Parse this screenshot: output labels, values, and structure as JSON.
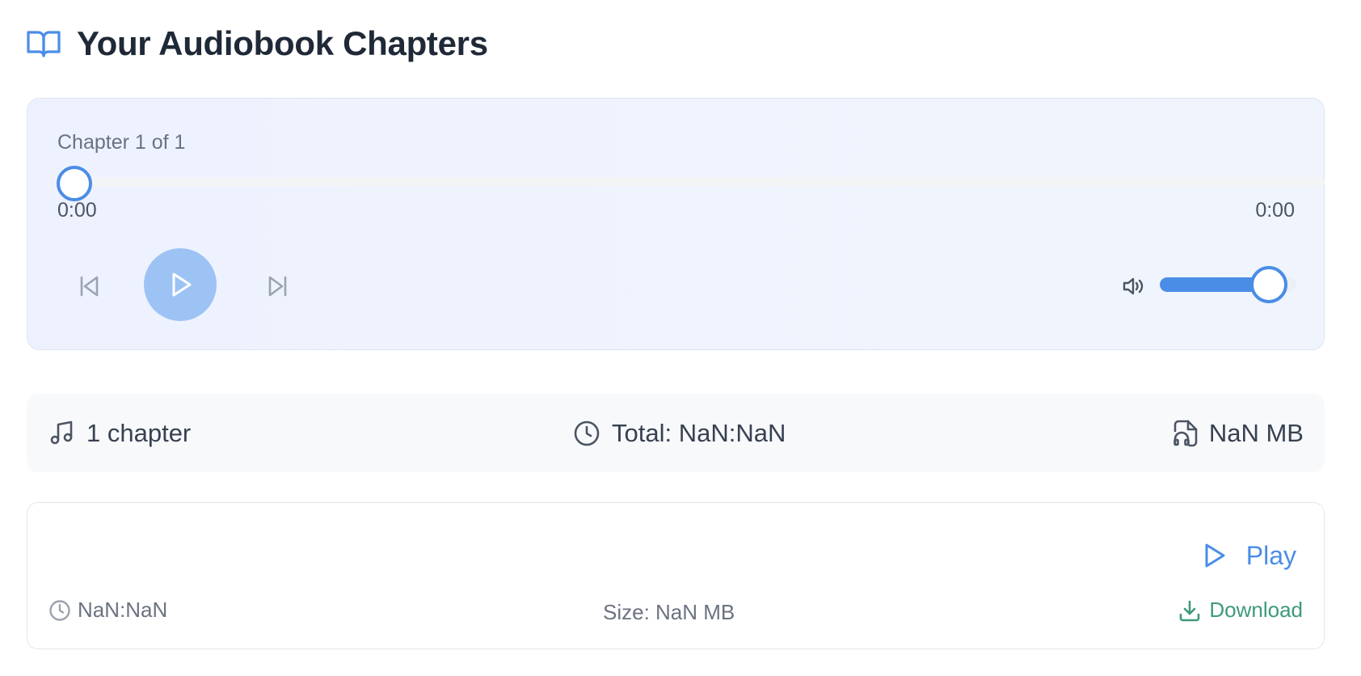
{
  "header": {
    "title": "Your Audiobook Chapters",
    "icon": "book-open-icon"
  },
  "player": {
    "chapter_label": "Chapter 1 of 1",
    "current_time": "0:00",
    "duration": "0:00",
    "progress": 0,
    "volume": 0.8,
    "play_state": "paused"
  },
  "summary": {
    "chapters": "1 chapter",
    "total": "Total: NaN:NaN",
    "size": "NaN MB"
  },
  "chapters": [
    {
      "play_label": "Play",
      "duration": "NaN:NaN",
      "size": "Size: NaN MB",
      "download_label": "Download"
    }
  ],
  "colors": {
    "accent": "#4a8de6",
    "play_button": "#9dc3f4",
    "download": "#3d9a7a",
    "player_bg": "#eef2fe"
  }
}
